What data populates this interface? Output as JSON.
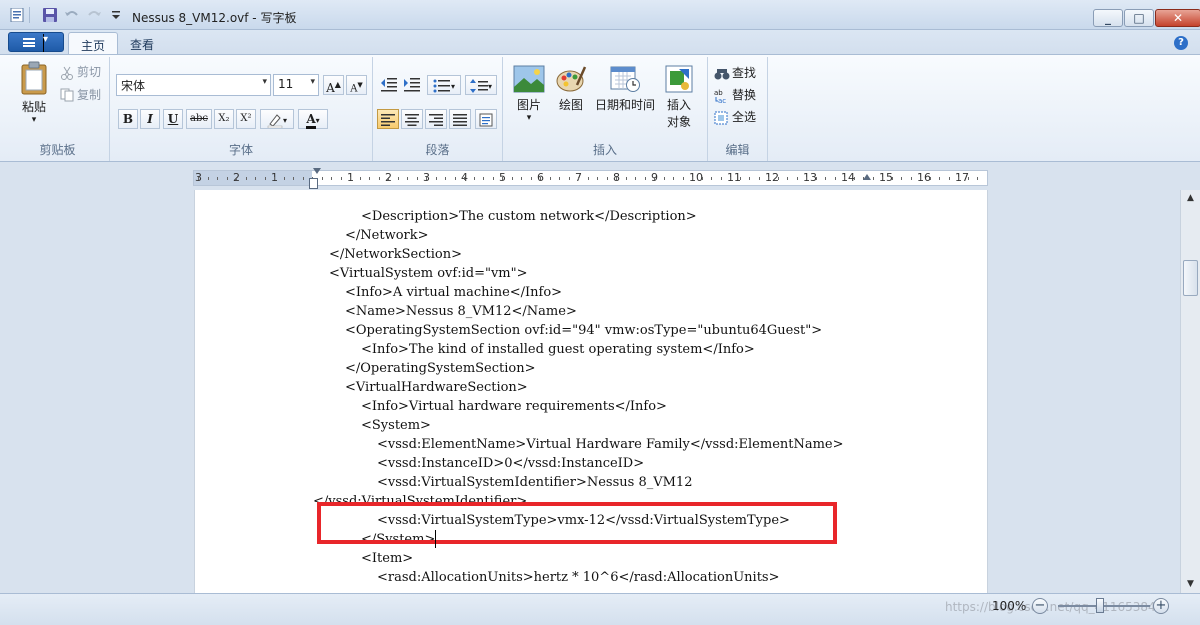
{
  "window": {
    "title": "Nessus 8_VM12.ovf - 写字板"
  },
  "tabs": {
    "file_caret": "▾",
    "home": "主页",
    "view": "查看",
    "help": "?"
  },
  "clipboard": {
    "paste": "粘贴",
    "cut": "剪切",
    "copy": "复制",
    "group": "剪贴板"
  },
  "font": {
    "family": "宋体",
    "size": "11",
    "group": "字体",
    "bold": "B",
    "italic": "I",
    "underline": "U",
    "strike": "abc",
    "sub": "X₂",
    "sup": "X²",
    "grow": "A",
    "shrink": "A",
    "color_letter": "A"
  },
  "paragraph": {
    "group": "段落"
  },
  "insert": {
    "picture": "图片",
    "paint": "绘图",
    "datetime": "日期和时间",
    "object_1": "插入",
    "object_2": "对象",
    "group": "插入"
  },
  "editing": {
    "find": "查找",
    "replace": "替换",
    "select_all": "全选",
    "group": "编辑"
  },
  "ruler": {
    "labels": [
      "3",
      "2",
      "1",
      "1",
      "2",
      "3",
      "4",
      "5",
      "6",
      "7",
      "8",
      "9",
      "10",
      "11",
      "12",
      "13",
      "14",
      "15",
      "16",
      "17"
    ]
  },
  "document": {
    "lines": [
      "<Description>The custom network</Description>",
      "</Network>",
      "</NetworkSection>",
      "<VirtualSystem ovf:id=\"vm\">",
      "<Info>A virtual machine</Info>",
      "<Name>Nessus 8_VM12</Name>",
      "<OperatingSystemSection ovf:id=\"94\" vmw:osType=\"ubuntu64Guest\">",
      "<Info>The kind of installed guest operating system</Info>",
      "</OperatingSystemSection>",
      "<VirtualHardwareSection>",
      "<Info>Virtual hardware requirements</Info>",
      "<System>",
      "<vssd:ElementName>Virtual Hardware Family</vssd:ElementName>",
      "<vssd:InstanceID>0</vssd:InstanceID>",
      "<vssd:VirtualSystemIdentifier>Nessus 8_VM12",
      "</vssd:VirtualSystemIdentifier>",
      "<vssd:VirtualSystemType>vmx-12</vssd:VirtualSystemType>",
      "</System>",
      "<Item>",
      "<rasd:AllocationUnits>hertz * 10^6</rasd:AllocationUnits>"
    ]
  },
  "status": {
    "zoom": "100%",
    "minus": "−",
    "plus": "+",
    "watermark": "https://blog.csdn.net/qq_41165384"
  },
  "colors": {
    "highlight": "#e8262a"
  }
}
